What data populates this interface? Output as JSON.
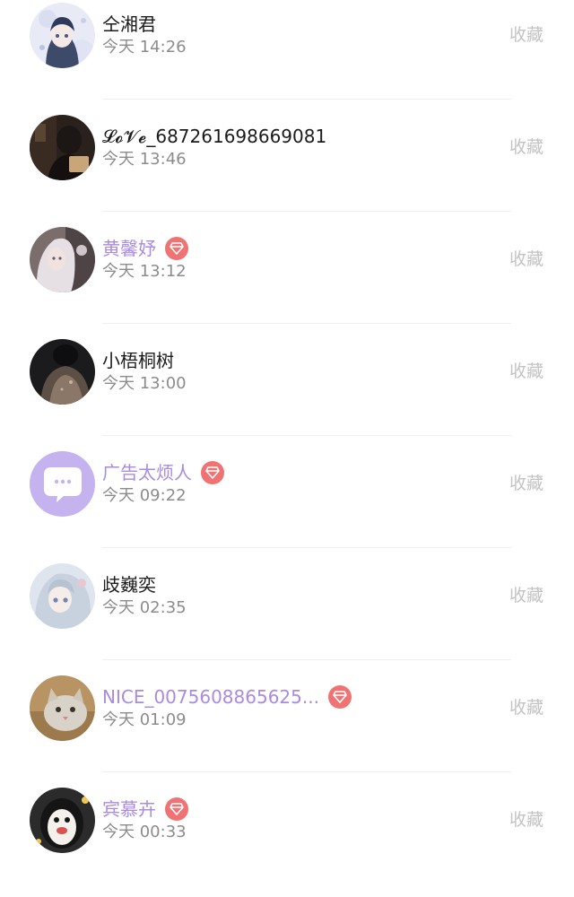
{
  "favorite_label": "收藏",
  "colors": {
    "vip_name": "#a98be0",
    "normal_name": "#1b1b1b",
    "time": "#8c8c8c",
    "favorite": "#c3c3c3",
    "badge": "#f07373"
  },
  "users": [
    {
      "name": "仝湘君",
      "time": "今天 14:26",
      "vip": false,
      "avatar": "anime-girl-avatar"
    },
    {
      "name": "𝓛𝓸𝓥𝓮_687261698669081",
      "time": "今天 13:46",
      "vip": false,
      "avatar": "dark-photo-avatar"
    },
    {
      "name": "黄馨妤",
      "time": "今天 13:12",
      "vip": true,
      "avatar": "white-hair-girl-avatar"
    },
    {
      "name": "小梧桐树",
      "time": "今天 13:00",
      "vip": false,
      "avatar": "dark-back-avatar"
    },
    {
      "name": "广告太烦人",
      "time": "今天 09:22",
      "vip": true,
      "avatar": "chat-bubble-avatar"
    },
    {
      "name": "歧巍奕",
      "time": "今天 02:35",
      "vip": false,
      "avatar": "anime-silver-girl-avatar"
    },
    {
      "name": "NICE_0075608865625...",
      "time": "今天 01:09",
      "vip": true,
      "avatar": "cat-avatar"
    },
    {
      "name": "宾慕卉",
      "time": "今天 00:33",
      "vip": true,
      "avatar": "penguin-avatar"
    }
  ]
}
